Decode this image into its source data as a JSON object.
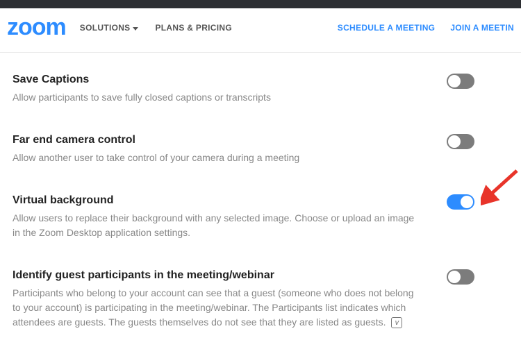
{
  "header": {
    "logo_text": "zoom",
    "nav": {
      "solutions": "SOLUTIONS",
      "plans": "PLANS & PRICING"
    },
    "right": {
      "schedule": "SCHEDULE A MEETING",
      "join": "JOIN A MEETIN"
    }
  },
  "settings": [
    {
      "title": "Save Captions",
      "desc": "Allow participants to save fully closed captions or transcripts",
      "enabled": false
    },
    {
      "title": "Far end camera control",
      "desc": "Allow another user to take control of your camera during a meeting",
      "enabled": false
    },
    {
      "title": "Virtual background",
      "desc": "Allow users to replace their background with any selected image. Choose or upload an image in the Zoom Desktop application settings.",
      "enabled": true
    },
    {
      "title": "Identify guest participants in the meeting/webinar",
      "desc": "Participants who belong to your account can see that a guest (someone who does not belong to your account) is participating in the meeting/webinar. The Participants list indicates which attendees are guests. The guests themselves do not see that they are listed as guests.",
      "enabled": false,
      "has_info": true
    }
  ],
  "annotation": {
    "arrow_color": "#e8342a"
  }
}
